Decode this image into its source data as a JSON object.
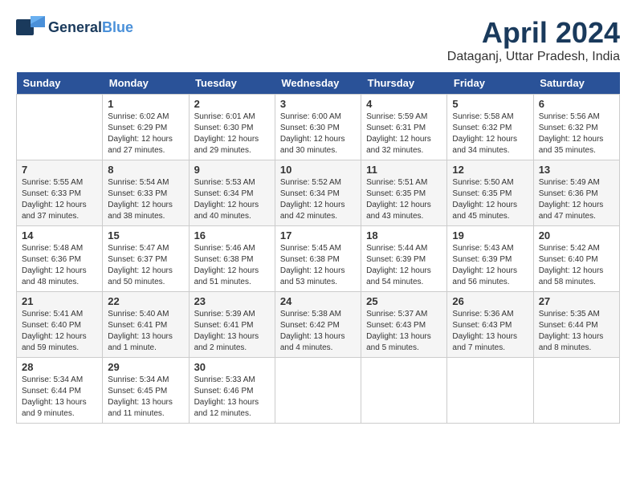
{
  "logo": {
    "general": "General",
    "blue": "Blue"
  },
  "title": "April 2024",
  "location": "Dataganj, Uttar Pradesh, India",
  "days_of_week": [
    "Sunday",
    "Monday",
    "Tuesday",
    "Wednesday",
    "Thursday",
    "Friday",
    "Saturday"
  ],
  "weeks": [
    [
      {
        "day": "",
        "detail": ""
      },
      {
        "day": "1",
        "detail": "Sunrise: 6:02 AM\nSunset: 6:29 PM\nDaylight: 12 hours\nand 27 minutes."
      },
      {
        "day": "2",
        "detail": "Sunrise: 6:01 AM\nSunset: 6:30 PM\nDaylight: 12 hours\nand 29 minutes."
      },
      {
        "day": "3",
        "detail": "Sunrise: 6:00 AM\nSunset: 6:30 PM\nDaylight: 12 hours\nand 30 minutes."
      },
      {
        "day": "4",
        "detail": "Sunrise: 5:59 AM\nSunset: 6:31 PM\nDaylight: 12 hours\nand 32 minutes."
      },
      {
        "day": "5",
        "detail": "Sunrise: 5:58 AM\nSunset: 6:32 PM\nDaylight: 12 hours\nand 34 minutes."
      },
      {
        "day": "6",
        "detail": "Sunrise: 5:56 AM\nSunset: 6:32 PM\nDaylight: 12 hours\nand 35 minutes."
      }
    ],
    [
      {
        "day": "7",
        "detail": "Sunrise: 5:55 AM\nSunset: 6:33 PM\nDaylight: 12 hours\nand 37 minutes."
      },
      {
        "day": "8",
        "detail": "Sunrise: 5:54 AM\nSunset: 6:33 PM\nDaylight: 12 hours\nand 38 minutes."
      },
      {
        "day": "9",
        "detail": "Sunrise: 5:53 AM\nSunset: 6:34 PM\nDaylight: 12 hours\nand 40 minutes."
      },
      {
        "day": "10",
        "detail": "Sunrise: 5:52 AM\nSunset: 6:34 PM\nDaylight: 12 hours\nand 42 minutes."
      },
      {
        "day": "11",
        "detail": "Sunrise: 5:51 AM\nSunset: 6:35 PM\nDaylight: 12 hours\nand 43 minutes."
      },
      {
        "day": "12",
        "detail": "Sunrise: 5:50 AM\nSunset: 6:35 PM\nDaylight: 12 hours\nand 45 minutes."
      },
      {
        "day": "13",
        "detail": "Sunrise: 5:49 AM\nSunset: 6:36 PM\nDaylight: 12 hours\nand 47 minutes."
      }
    ],
    [
      {
        "day": "14",
        "detail": "Sunrise: 5:48 AM\nSunset: 6:36 PM\nDaylight: 12 hours\nand 48 minutes."
      },
      {
        "day": "15",
        "detail": "Sunrise: 5:47 AM\nSunset: 6:37 PM\nDaylight: 12 hours\nand 50 minutes."
      },
      {
        "day": "16",
        "detail": "Sunrise: 5:46 AM\nSunset: 6:38 PM\nDaylight: 12 hours\nand 51 minutes."
      },
      {
        "day": "17",
        "detail": "Sunrise: 5:45 AM\nSunset: 6:38 PM\nDaylight: 12 hours\nand 53 minutes."
      },
      {
        "day": "18",
        "detail": "Sunrise: 5:44 AM\nSunset: 6:39 PM\nDaylight: 12 hours\nand 54 minutes."
      },
      {
        "day": "19",
        "detail": "Sunrise: 5:43 AM\nSunset: 6:39 PM\nDaylight: 12 hours\nand 56 minutes."
      },
      {
        "day": "20",
        "detail": "Sunrise: 5:42 AM\nSunset: 6:40 PM\nDaylight: 12 hours\nand 58 minutes."
      }
    ],
    [
      {
        "day": "21",
        "detail": "Sunrise: 5:41 AM\nSunset: 6:40 PM\nDaylight: 12 hours\nand 59 minutes."
      },
      {
        "day": "22",
        "detail": "Sunrise: 5:40 AM\nSunset: 6:41 PM\nDaylight: 13 hours\nand 1 minute."
      },
      {
        "day": "23",
        "detail": "Sunrise: 5:39 AM\nSunset: 6:41 PM\nDaylight: 13 hours\nand 2 minutes."
      },
      {
        "day": "24",
        "detail": "Sunrise: 5:38 AM\nSunset: 6:42 PM\nDaylight: 13 hours\nand 4 minutes."
      },
      {
        "day": "25",
        "detail": "Sunrise: 5:37 AM\nSunset: 6:43 PM\nDaylight: 13 hours\nand 5 minutes."
      },
      {
        "day": "26",
        "detail": "Sunrise: 5:36 AM\nSunset: 6:43 PM\nDaylight: 13 hours\nand 7 minutes."
      },
      {
        "day": "27",
        "detail": "Sunrise: 5:35 AM\nSunset: 6:44 PM\nDaylight: 13 hours\nand 8 minutes."
      }
    ],
    [
      {
        "day": "28",
        "detail": "Sunrise: 5:34 AM\nSunset: 6:44 PM\nDaylight: 13 hours\nand 9 minutes."
      },
      {
        "day": "29",
        "detail": "Sunrise: 5:34 AM\nSunset: 6:45 PM\nDaylight: 13 hours\nand 11 minutes."
      },
      {
        "day": "30",
        "detail": "Sunrise: 5:33 AM\nSunset: 6:46 PM\nDaylight: 13 hours\nand 12 minutes."
      },
      {
        "day": "",
        "detail": ""
      },
      {
        "day": "",
        "detail": ""
      },
      {
        "day": "",
        "detail": ""
      },
      {
        "day": "",
        "detail": ""
      }
    ]
  ]
}
